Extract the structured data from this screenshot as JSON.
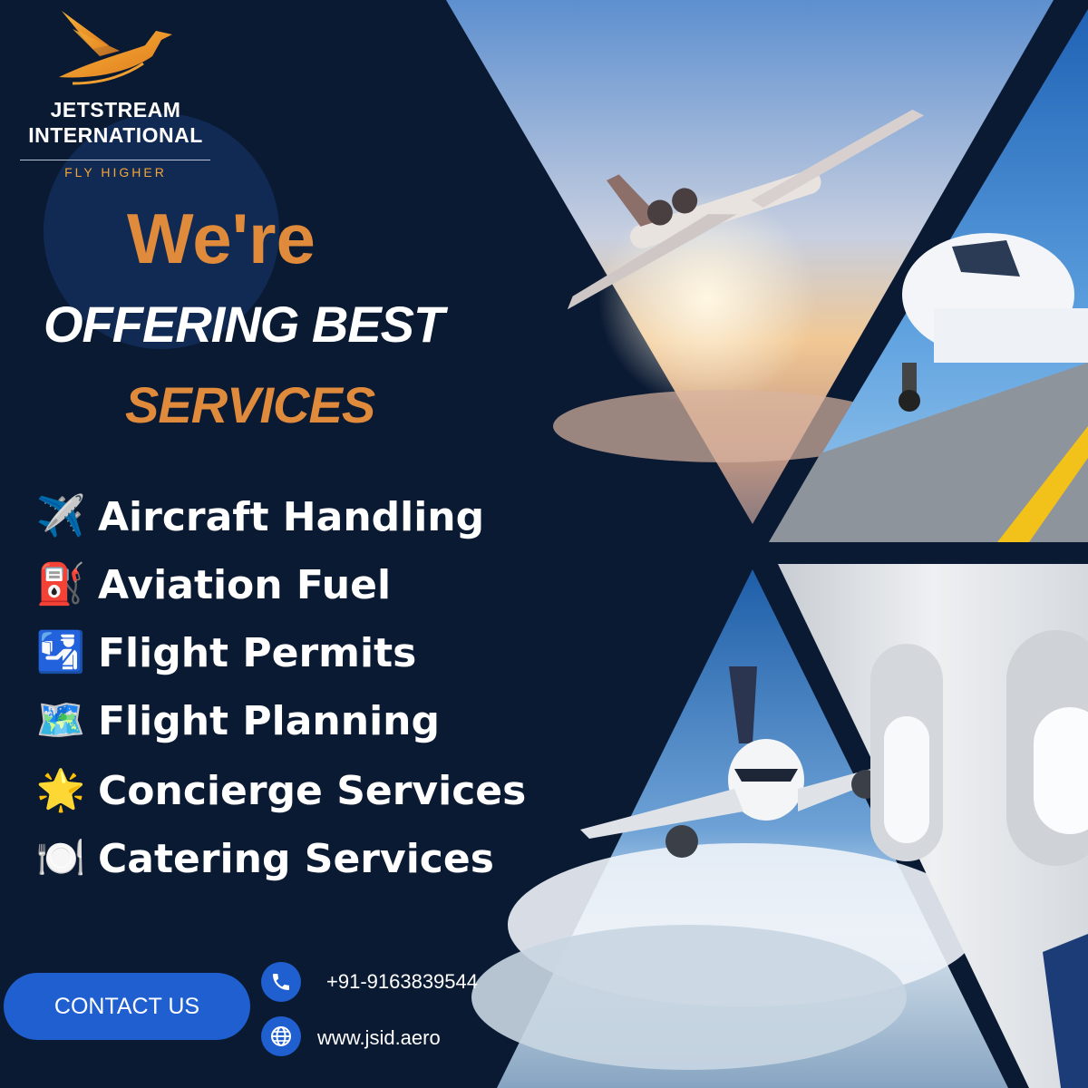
{
  "brand": {
    "name_line_1": "JETSTREAM",
    "name_line_2": "INTERNATIONAL",
    "tagline": "FLY HIGHER",
    "logo_icon": "bird-wing-icon"
  },
  "headline": {
    "line_1": "We're",
    "line_2": "OFFERING BEST",
    "line_3": "SERVICES"
  },
  "services": [
    {
      "emoji": "✈️",
      "icon": "airplane-icon",
      "label": "Aircraft Handling"
    },
    {
      "emoji": "⛽",
      "icon": "fuel-pump-icon",
      "label": "Aviation Fuel"
    },
    {
      "emoji": "🛂",
      "icon": "passport-control-icon",
      "label": "Flight Permits"
    },
    {
      "emoji": "🗺️",
      "icon": "world-map-icon",
      "label": "Flight Planning"
    },
    {
      "emoji": "🌟",
      "icon": "glowing-star-icon",
      "label": "Concierge Services"
    },
    {
      "emoji": "🍽️",
      "icon": "plate-cutlery-icon",
      "label": "Catering Services"
    }
  ],
  "contact": {
    "button_label": "CONTACT US",
    "phone": "+91-9163839544",
    "website": "www.jsid.aero"
  },
  "colors": {
    "background": "#0b1a33",
    "accent_orange": "#e08a3c",
    "tagline_orange": "#f3a43a",
    "button_blue": "#1f5fcf"
  }
}
